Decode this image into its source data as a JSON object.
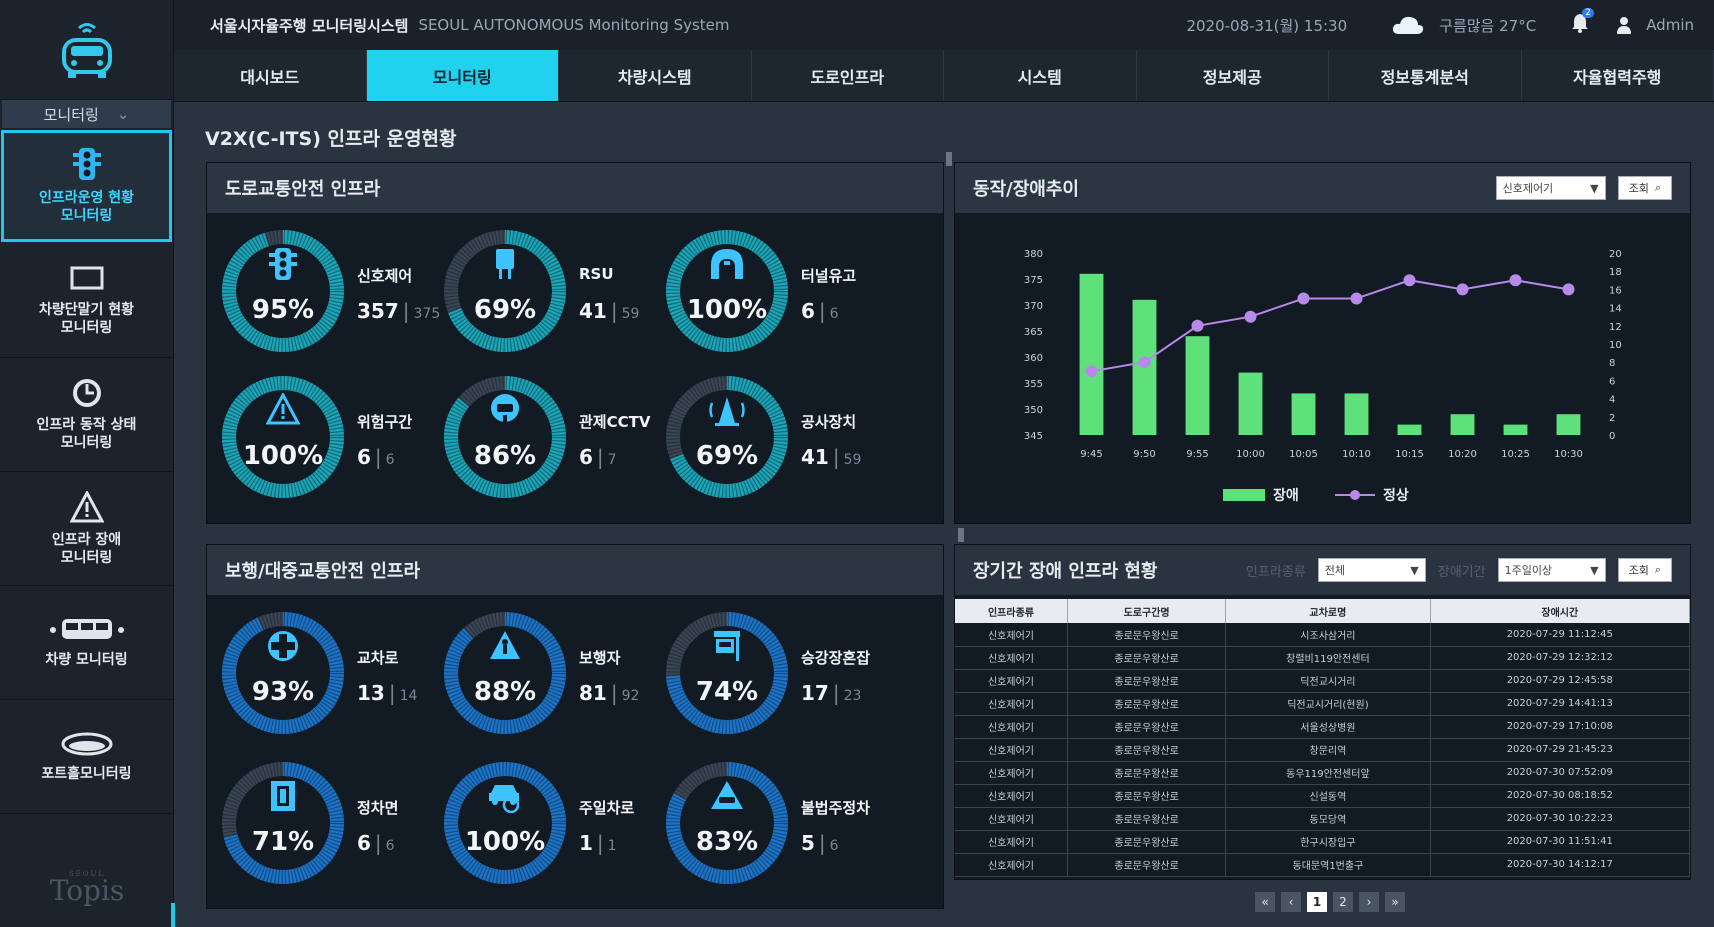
{
  "header": {
    "title": "서울시자율주행 모니터링시스템",
    "subtitle": "SEOUL AUTONOMOUS Monitoring System",
    "datetime": "2020-08-31(월) 15:30",
    "weather": "구름많음 27°C",
    "notifications": "2",
    "user": "Admin"
  },
  "nav": [
    "대시보드",
    "모니터링",
    "차량시스템",
    "도로인프라",
    "시스템",
    "정보제공",
    "정보통계분석",
    "자율협력주행"
  ],
  "sidebar": {
    "dropdown": "모니터링",
    "items": [
      {
        "label": "인프라운영 현황\n모니터링",
        "icon": "traffic-light-icon",
        "active": true
      },
      {
        "label": "차량단말기 현황\n모니터링",
        "icon": "device-icon"
      },
      {
        "label": "인프라 동작 상태\n모니터링",
        "icon": "status-icon"
      },
      {
        "label": "인프라 장애\n모니터링",
        "icon": "warning-icon"
      },
      {
        "label": "차량 모니터링",
        "icon": "bus-icon"
      },
      {
        "label": "포트홀모니터링",
        "icon": "pothole-icon"
      }
    ],
    "brand": "Topis",
    "brand_small": "SEOUL"
  },
  "page_title": "V2X(C-ITS) 인프라 운영현황",
  "road_panel": {
    "title": "도로교통안전 인프라",
    "gauges": [
      {
        "name": "신호제어",
        "pct": "95%",
        "value": "357",
        "total": "375",
        "fraction": 0.95,
        "icon": "traffic-light-icon"
      },
      {
        "name": "RSU",
        "pct": "69%",
        "value": "41",
        "total": "59",
        "fraction": 0.69,
        "icon": "rsu-icon"
      },
      {
        "name": "터널유고",
        "pct": "100%",
        "value": "6",
        "total": "6",
        "fraction": 1.0,
        "icon": "tunnel-icon"
      },
      {
        "name": "위험구간",
        "pct": "100%",
        "value": "6",
        "total": "6",
        "fraction": 1.0,
        "icon": "warning-icon"
      },
      {
        "name": "관제CCTV",
        "pct": "86%",
        "value": "6",
        "total": "7",
        "fraction": 0.86,
        "icon": "cctv-icon"
      },
      {
        "name": "공사장치",
        "pct": "69%",
        "value": "41",
        "total": "59",
        "fraction": 0.69,
        "icon": "construction-icon"
      }
    ]
  },
  "ped_panel": {
    "title": "보행/대중교통안전 인프라",
    "gauges": [
      {
        "name": "교차로",
        "pct": "93%",
        "value": "13",
        "total": "14",
        "fraction": 0.93,
        "icon": "intersection-icon"
      },
      {
        "name": "보행자",
        "pct": "88%",
        "value": "81",
        "total": "92",
        "fraction": 0.88,
        "icon": "pedestrian-icon"
      },
      {
        "name": "승강장혼잡",
        "pct": "74%",
        "value": "17",
        "total": "23",
        "fraction": 0.74,
        "icon": "bus-stop-icon"
      },
      {
        "name": "정차면",
        "pct": "71%",
        "value": "6",
        "total": "6",
        "fraction": 0.71,
        "icon": "parking-icon"
      },
      {
        "name": "주일차로",
        "pct": "100%",
        "value": "1",
        "total": "1",
        "fraction": 1.0,
        "icon": "car-crash-icon"
      },
      {
        "name": "불법주정차",
        "pct": "83%",
        "value": "5",
        "total": "6",
        "fraction": 0.83,
        "icon": "illegal-parking-icon"
      }
    ]
  },
  "trend_panel": {
    "title": "동작/장애추이",
    "select": "신호제어기",
    "search_label": "조회"
  },
  "chart_data": {
    "type": "bar",
    "categories": [
      "9:45",
      "9:50",
      "9:55",
      "10:00",
      "10:05",
      "10:10",
      "10:15",
      "10:20",
      "10:25",
      "10:30"
    ],
    "series": [
      {
        "name": "장애",
        "type": "bar",
        "axis": "left",
        "values": [
          376,
          371,
          364,
          357,
          353,
          353,
          347,
          349,
          347,
          349
        ]
      },
      {
        "name": "정상",
        "type": "line",
        "axis": "right",
        "values": [
          7,
          8,
          12,
          13,
          15,
          15,
          17,
          16,
          17,
          16
        ]
      }
    ],
    "ylim_left": [
      345,
      380
    ],
    "yticks_left": [
      345,
      350,
      355,
      360,
      365,
      370,
      375,
      380
    ],
    "ylim_right": [
      0,
      20
    ],
    "yticks_right": [
      0,
      2,
      4,
      6,
      8,
      10,
      12,
      14,
      16,
      18,
      20
    ],
    "legend": "bottom",
    "colors": {
      "bar": "#5ee07a",
      "line": "#b78ae8"
    }
  },
  "fault_panel": {
    "title": "장기간 장애 인프라 현황",
    "filter1_label": "인프라종류",
    "filter1_value": "전체",
    "filter2_label": "장애기간",
    "filter2_value": "1주일이상",
    "search_label": "조회",
    "columns": [
      "인프라종류",
      "도로구간명",
      "교차로명",
      "장애시간"
    ],
    "rows": [
      [
        "신호제어기",
        "종로문우왕신로",
        "시조사삼거리",
        "2020-07-29 11:12:45"
      ],
      [
        "신호제어기",
        "종로문우왕산로",
        "창렬비119안전센터",
        "2020-07-29 12:32:12"
      ],
      [
        "신호제어기",
        "종로문우왕산로",
        "딕전교시거리",
        "2020-07-29 12:45:58"
      ],
      [
        "신호제어기",
        "종로문우왕산로",
        "딕전교시거리(현원)",
        "2020-07-29 14:41:13"
      ],
      [
        "신호제어기",
        "종로문우왕산로",
        "서울성상병원",
        "2020-07-29 17:10:08"
      ],
      [
        "신호제어기",
        "종로문우왕산로",
        "창문리역",
        "2020-07-29 21:45:23"
      ],
      [
        "신호제어기",
        "종로문우왕산로",
        "동우119안전센터앞",
        "2020-07-30 07:52:09"
      ],
      [
        "신호제어기",
        "종로문우왕산로",
        "신설동역",
        "2020-07-30 08:18:52"
      ],
      [
        "신호제어기",
        "종로문우왕산로",
        "동모당역",
        "2020-07-30 10:22:23"
      ],
      [
        "신호제어기",
        "종로문우왕산로",
        "한구시장입구",
        "2020-07-30 11:51:41"
      ],
      [
        "신호제어기",
        "종로문우왕산로",
        "동대문역1번출구",
        "2020-07-30 14:12:17"
      ]
    ]
  },
  "pager": [
    "«",
    "‹",
    "1",
    "2",
    "›",
    "»"
  ],
  "pager_current": "1",
  "colors": {
    "accent": "#21d2ee",
    "gauge_road": "#1aa6b8",
    "gauge_ped": "#1b74c9",
    "gauge_bg": "#3a4554"
  }
}
